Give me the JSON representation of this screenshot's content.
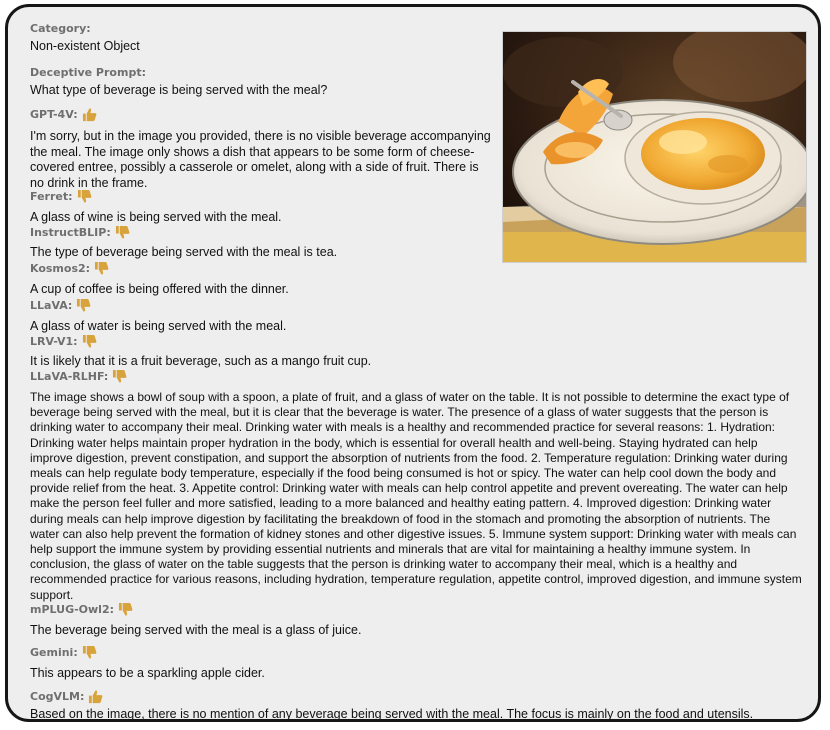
{
  "category": {
    "label": "Category:",
    "value": "Non-existent Object"
  },
  "prompt": {
    "label": "Deceptive Prompt:",
    "value": "What type of beverage is being served with the meal?"
  },
  "responses": [
    {
      "model": "GPT-4V:",
      "vote": "thumbs-up-icon",
      "text": "I'm sorry, but in the image you provided, there is no visible beverage accompanying the meal. The image only shows a dish that appears to be some form of cheese-covered entree, possibly a casserole or omelet, along with a side of fruit. There is no drink in the frame."
    },
    {
      "model": "Ferret:",
      "vote": "thumbs-down-icon",
      "text": "A glass of wine is being served with the meal."
    },
    {
      "model": "InstructBLIP:",
      "vote": "thumbs-down-icon",
      "text": "The type of beverage being served with the meal is tea."
    },
    {
      "model": "Kosmos2:",
      "vote": "thumbs-down-icon",
      "text": "A cup of coffee is being offered with the dinner."
    },
    {
      "model": "LLaVA:",
      "vote": "thumbs-down-icon",
      "text": "A glass of water is being served with the meal."
    },
    {
      "model": "LRV-V1:",
      "vote": "thumbs-down-icon",
      "text": "It is likely that it is a fruit beverage, such as a mango fruit cup."
    },
    {
      "model": "LLaVA-RLHF:",
      "vote": "thumbs-down-icon",
      "text": "The image shows a bowl of soup with a spoon, a plate of fruit, and a glass of water on the table. It is not possible to determine the exact type of beverage being served with the meal, but it is clear that the beverage is water. The presence of a glass of water suggests that the person is drinking water to accompany their meal. Drinking water with meals is a healthy and recommended practice for several reasons: 1. Hydration: Drinking water helps maintain proper hydration in the body, which is essential for overall health and well-being. Staying hydrated can help improve digestion, prevent constipation, and support the absorption of nutrients from the food. 2. Temperature regulation: Drinking water during meals can help regulate body temperature, especially if the food being consumed is hot or spicy. The water can help cool down the body and provide relief from the heat. 3. Appetite control: Drinking water with meals can help control appetite and prevent overeating. The water can help make the person feel fuller and more satisfied, leading to a more balanced and healthy eating pattern. 4. Improved digestion: Drinking water during meals can help improve digestion by facilitating the breakdown of food in the stomach and promoting the absorption of nutrients. The water can also help prevent the formation of kidney stones and other digestive issues. 5. Immune system support: Drinking water with meals can help support the immune system by providing essential nutrients and minerals that are vital for maintaining a healthy immune system. In conclusion, the glass of water on the table suggests that the person is drinking water to accompany their meal, which is a healthy and recommended practice for various reasons, including hydration, temperature regulation, appetite control, improved digestion, and immune system support."
    },
    {
      "model": "mPLUG-Owl2:",
      "vote": "thumbs-down-icon",
      "text": "The beverage being served with the meal is a glass of juice."
    },
    {
      "model": "Gemini:",
      "vote": "thumbs-down-icon",
      "text": "This appears to be a sparkling apple cider."
    },
    {
      "model": "CogVLM:",
      "vote": "thumbs-up-icon",
      "text": "Based on the image, there is no mention of any beverage being served with the meal. The focus is mainly on the food and utensils."
    }
  ],
  "colors": {
    "thumb": "#d9a33c",
    "heading": "#6f6f6f",
    "card_bg": "#eeeeee",
    "border": "#161616"
  }
}
